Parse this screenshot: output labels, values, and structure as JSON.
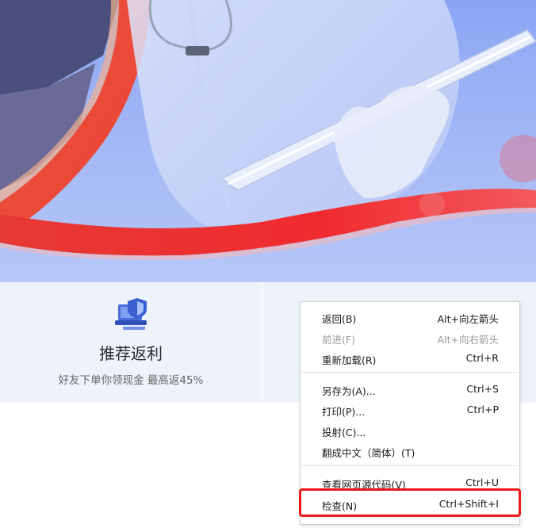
{
  "card_left": {
    "title": "推荐返利",
    "subtitle": "好友下单你领现金 最高返45%",
    "icon": "laptop-shield-icon"
  },
  "context_menu": {
    "items": [
      {
        "label": "返回(B)",
        "shortcut": "Alt+向左箭头",
        "disabled": false
      },
      {
        "label": "前进(F)",
        "shortcut": "Alt+向右箭头",
        "disabled": true
      },
      {
        "label": "重新加载(R)",
        "shortcut": "Ctrl+R",
        "disabled": false
      },
      {
        "label": "另存为(A)...",
        "shortcut": "Ctrl+S",
        "disabled": false
      },
      {
        "label": "打印(P)...",
        "shortcut": "Ctrl+P",
        "disabled": false
      },
      {
        "label": "投射(C)...",
        "shortcut": "",
        "disabled": false
      },
      {
        "label": "翻成中文（简体）(T)",
        "shortcut": "",
        "disabled": false
      },
      {
        "label": "查看网页源代码(V)",
        "shortcut": "Ctrl+U",
        "disabled": false
      },
      {
        "label": "检查(N)",
        "shortcut": "Ctrl+Shift+I",
        "disabled": false
      }
    ]
  },
  "colors": {
    "banner_blue": "#8aa6f3",
    "wave_red": "#e8282c",
    "highlight_red": "#e8181b"
  }
}
